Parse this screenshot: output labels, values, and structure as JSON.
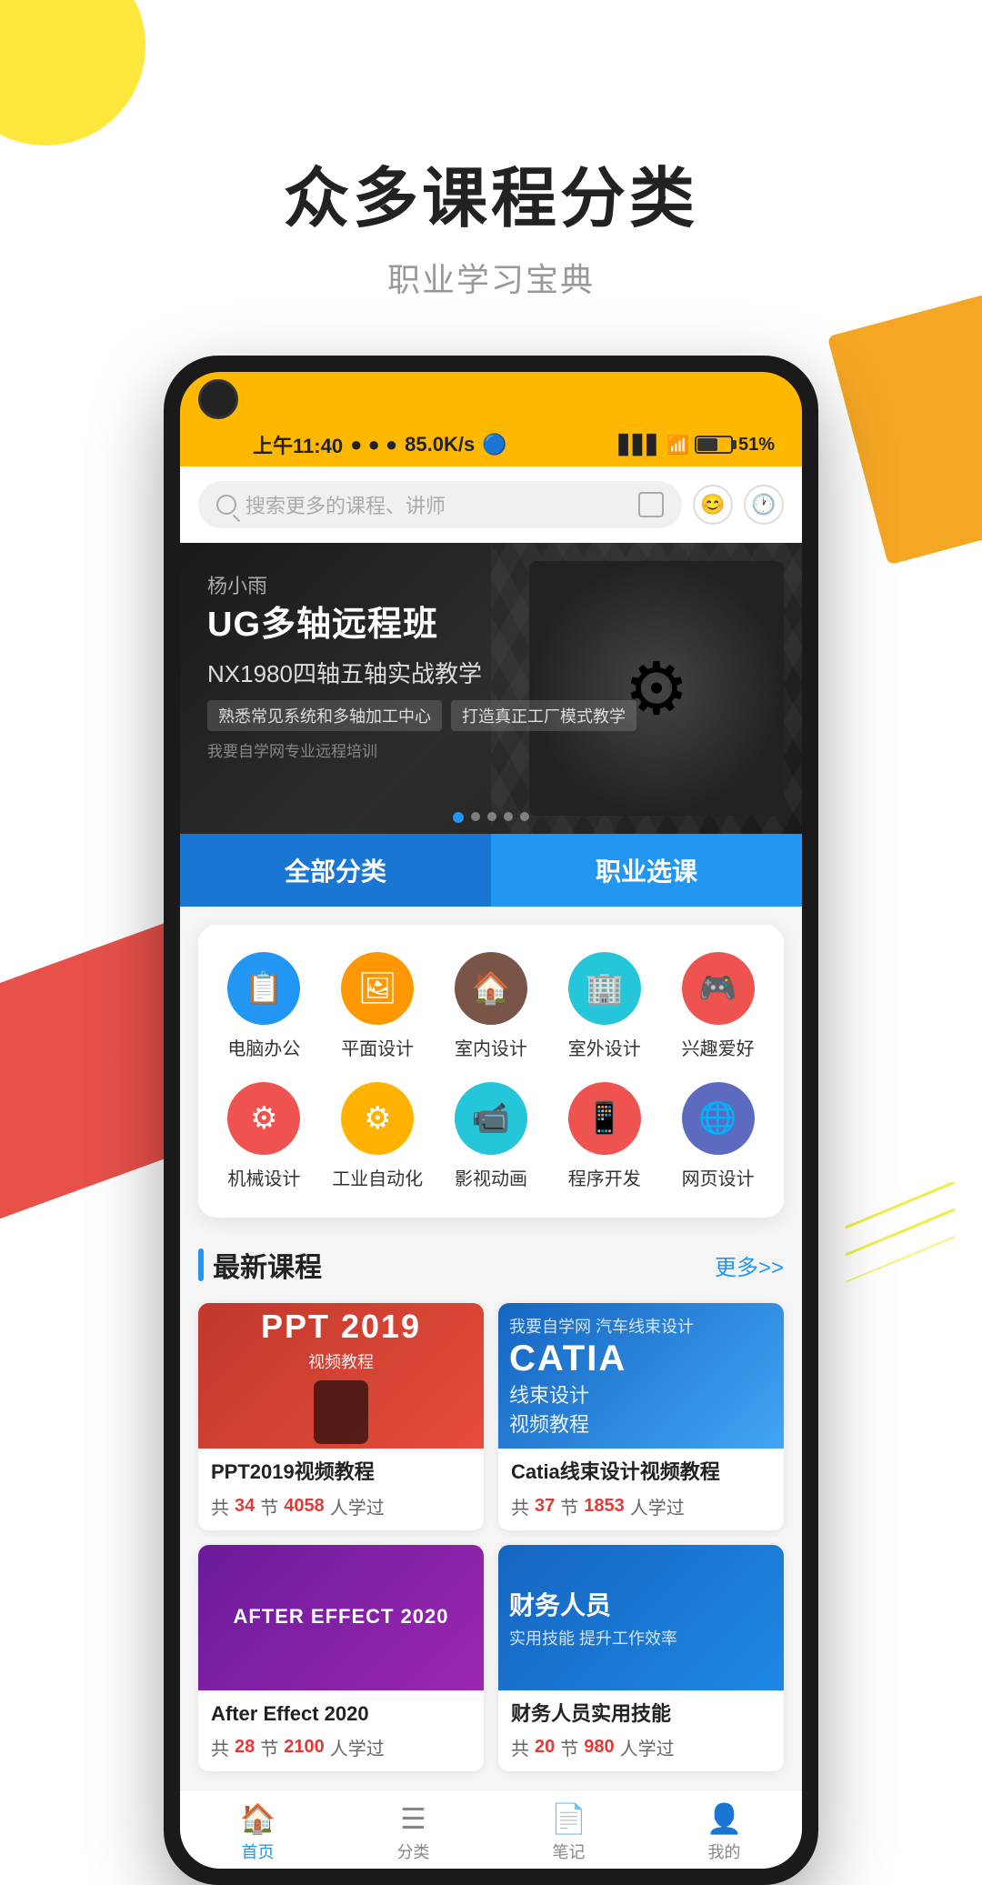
{
  "page": {
    "background": "#ffffff"
  },
  "decorations": {
    "yellow_circle": "yellow circle top-left",
    "orange_rect": "orange parallelogram top-right",
    "red_rects": "red parallelograms left side"
  },
  "header": {
    "title": "众多课程分类",
    "subtitle": "职业学习宝典"
  },
  "phone": {
    "status_bar": {
      "time": "上午11:40",
      "speed": "85.0K/s",
      "battery_percent": "51%",
      "dots": "● ● ●"
    },
    "search": {
      "placeholder": "搜索更多的课程、讲师",
      "scan_icon": "scan",
      "emoji_icon": "😊",
      "history_icon": "🕐"
    },
    "banner": {
      "teacher": "杨小雨",
      "title": "UG多轴远程班",
      "subtitle": "NX1980四轴五轴实战教学",
      "tags": [
        "熟悉常见系统和多轴加工中心",
        "打造真正工厂模式教学"
      ],
      "small_text": "我要自学网专业远程培训",
      "dots_count": 5,
      "active_dot": 0
    },
    "action_buttons": {
      "left": "全部分类",
      "right": "职业选课"
    },
    "categories": [
      {
        "id": "diannaobangong",
        "label": "电脑办公",
        "icon": "📋",
        "color": "#2196F3"
      },
      {
        "id": "pingmiansheji",
        "label": "平面设计",
        "icon": "🖼",
        "color": "#FF9800"
      },
      {
        "id": "shineisheji",
        "label": "室内设计",
        "icon": "🏠",
        "color": "#795548"
      },
      {
        "id": "shiwaisheji",
        "label": "室外设计",
        "icon": "🏢",
        "color": "#26C6DA"
      },
      {
        "id": "xingquaihao",
        "label": "兴趣爱好",
        "icon": "🎮",
        "color": "#EF5350"
      },
      {
        "id": "jixiesheji",
        "label": "机械设计",
        "icon": "⚙️",
        "color": "#EF5350"
      },
      {
        "id": "gongyezidonghua",
        "label": "工业自动化",
        "icon": "⚙",
        "color": "#FFB300"
      },
      {
        "id": "yingshidonghua",
        "label": "影视动画",
        "icon": "📹",
        "color": "#26C6DA"
      },
      {
        "id": "chengxukaifa",
        "label": "程序开发",
        "icon": "📱",
        "color": "#EF5350"
      },
      {
        "id": "wangyesheji",
        "label": "网页设计",
        "icon": "🌐",
        "color": "#5C6BC0"
      }
    ],
    "courses_section": {
      "title": "最新课程",
      "more_text": "更多>>",
      "courses": [
        {
          "id": "ppt2019",
          "name": "PPT2019视频教程",
          "thumb_type": "ppt",
          "thumb_title": "PPT 2019",
          "thumb_subtitle": "视频教程",
          "sections": "34",
          "students": "4058"
        },
        {
          "id": "catia",
          "name": "Catia线束设计视频教程",
          "thumb_type": "catia",
          "thumb_brand": "CATIA",
          "thumb_subtitle": "线束设计\n视频教程",
          "thumb_top": "我要自学网  汽车线束设计",
          "sections": "37",
          "students": "1853"
        },
        {
          "id": "aftereffect",
          "name": "AFTER EFFECT 2020",
          "thumb_type": "ae",
          "thumb_title": "AFTER EFFECT 2020",
          "sections": "28",
          "students": "2100"
        },
        {
          "id": "finance",
          "name": "财务人员",
          "thumb_type": "finance",
          "thumb_title": "财务人员",
          "thumb_subtitle": "实用技能 提升工作效率",
          "sections": "20",
          "students": "980"
        }
      ]
    },
    "bottom_nav": [
      {
        "id": "home",
        "icon": "🏠",
        "label": "首页",
        "active": true
      },
      {
        "id": "list",
        "icon": "☰",
        "label": "分类",
        "active": false
      },
      {
        "id": "notes",
        "icon": "📄",
        "label": "笔记",
        "active": false
      },
      {
        "id": "profile",
        "icon": "👤",
        "label": "我的",
        "active": false
      }
    ]
  }
}
